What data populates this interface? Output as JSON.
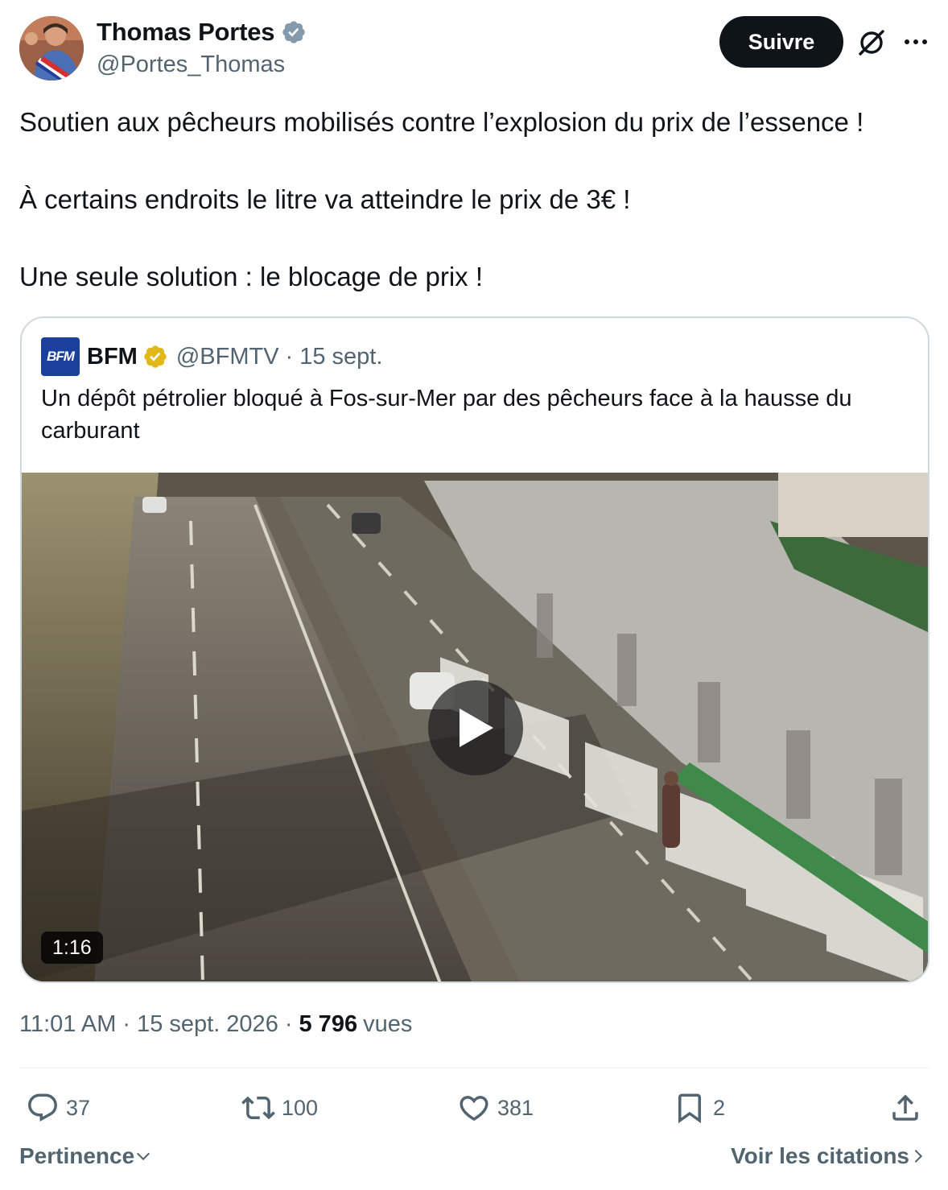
{
  "author": {
    "name": "Thomas Portes",
    "handle": "@Portes_Thomas"
  },
  "header": {
    "follow_label": "Suivre",
    "grok_icon": "grok-icon",
    "more_icon": "more-icon"
  },
  "tweet": {
    "paragraphs": [
      "Soutien aux pêcheurs mobilisés contre l’explosion du prix de l’essence !",
      "À certains endroits le litre va atteindre le prix de 3€ !",
      "Une seule solution : le blocage de prix !"
    ]
  },
  "quote": {
    "logo_text": "BFM",
    "name": "BFM",
    "handle": "@BFMTV",
    "separator": "·",
    "date": "15 sept.",
    "text": "Un dépôt pétrolier bloqué à Fos-sur-Mer par des pêcheurs face à la hausse du carburant",
    "video": {
      "duration": "1:16"
    }
  },
  "meta": {
    "time": "11:01 AM",
    "separator": "·",
    "date": "15 sept. 2026",
    "views_count": "5 796",
    "views_label": "vues"
  },
  "actions": {
    "replies": "37",
    "reposts": "100",
    "likes": "381",
    "bookmarks": "2"
  },
  "footer": {
    "sort_label": "Pertinence",
    "quotes_link": "Voir les citations"
  },
  "colors": {
    "text_primary": "#0f1419",
    "text_secondary": "#536471",
    "verified_blue": "#829aab",
    "verified_gold": "#e2b719",
    "border": "#cfd9de"
  }
}
